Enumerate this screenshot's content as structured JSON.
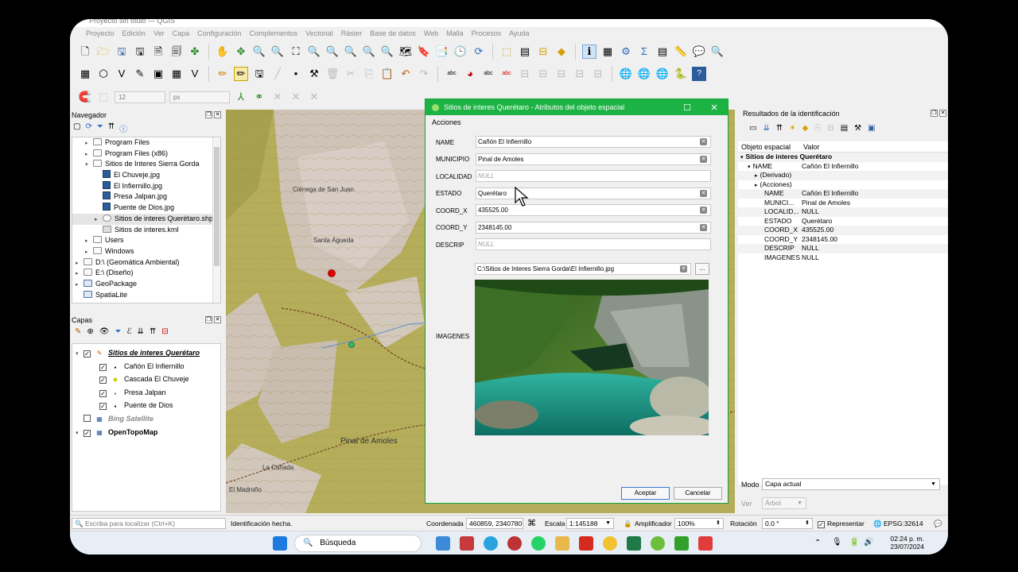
{
  "window": {
    "title": "Proyecto sin título — QGIS"
  },
  "menu": [
    "Proyecto",
    "Edición",
    "Ver",
    "Capa",
    "Configuración",
    "Complementos",
    "Vectorial",
    "Ráster",
    "Base de datos",
    "Web",
    "Malla",
    "Procesos",
    "Ayuda"
  ],
  "digitize": {
    "size_value": "12",
    "unit_value": "px"
  },
  "navigator": {
    "title": "Navegador",
    "items": [
      {
        "label": "Program Files",
        "indent": 1,
        "kind": "folder",
        "arrow": "▸"
      },
      {
        "label": "Program Files (x86)",
        "indent": 1,
        "kind": "folder",
        "arrow": "▸"
      },
      {
        "label": "Sitios de Interes Sierra Gorda",
        "indent": 1,
        "kind": "folder",
        "arrow": "▾"
      },
      {
        "label": "El Chuveje.jpg",
        "indent": 2,
        "kind": "image",
        "arrow": ""
      },
      {
        "label": "El Infiernillo.jpg",
        "indent": 2,
        "kind": "image",
        "arrow": ""
      },
      {
        "label": "Presa Jalpan.jpg",
        "indent": 2,
        "kind": "image",
        "arrow": ""
      },
      {
        "label": "Puente de Dios.jpg",
        "indent": 2,
        "kind": "image",
        "arrow": ""
      },
      {
        "label": "Sitios de interes Querétaro.shp",
        "indent": 2,
        "kind": "shp",
        "arrow": "▸"
      },
      {
        "label": "Sitios de interes.kml",
        "indent": 2,
        "kind": "kml",
        "arrow": ""
      },
      {
        "label": "Users",
        "indent": 1,
        "kind": "folder",
        "arrow": "▸"
      },
      {
        "label": "Windows",
        "indent": 1,
        "kind": "folder",
        "arrow": "▸"
      },
      {
        "label": "D:\\ (Geomática Ambiental)",
        "indent": 0,
        "kind": "folder",
        "arrow": "▸"
      },
      {
        "label": "E:\\ (Diseño)",
        "indent": 0,
        "kind": "folder",
        "arrow": "▸"
      },
      {
        "label": "GeoPackage",
        "indent": 0,
        "kind": "gpkg",
        "arrow": "▸"
      },
      {
        "label": "SpatiaLite",
        "indent": 0,
        "kind": "gpkg",
        "arrow": ""
      }
    ]
  },
  "layers": {
    "title": "Capas",
    "items": [
      {
        "label": "Sitios de interes Querétaro",
        "indent": 0,
        "checked": true,
        "style": "bold-underline",
        "sym": "pencil"
      },
      {
        "label": "Cañón El Infiernillo",
        "indent": 1,
        "checked": true,
        "style": "normal",
        "sym": "dot-black"
      },
      {
        "label": "Cascada El Chuveje",
        "indent": 1,
        "checked": true,
        "style": "normal",
        "sym": "diamond"
      },
      {
        "label": "Presa Jalpan",
        "indent": 1,
        "checked": true,
        "style": "normal",
        "sym": "dot-green"
      },
      {
        "label": "Puente de Dios",
        "indent": 1,
        "checked": true,
        "style": "normal",
        "sym": "dot-black"
      },
      {
        "label": "Bing Satellite",
        "indent": 0,
        "checked": false,
        "style": "italic-gray",
        "sym": "raster"
      },
      {
        "label": "OpenTopoMap",
        "indent": 0,
        "checked": true,
        "style": "bold",
        "sym": "raster"
      }
    ]
  },
  "map": {
    "labels": [
      "Ciénega de San Juan",
      "Santa Águeda",
      "Pinal de Amoles",
      "La Cañada",
      "El Madroño"
    ]
  },
  "dialog": {
    "title": "Sitios de interes Querétaro - Atributos del objeto espacial",
    "menu_actions": "Acciones",
    "fields": [
      {
        "label": "NAME",
        "value": "Cañón El Infiernillo",
        "null": false
      },
      {
        "label": "MUNICIPIO",
        "value": "Pinal de Amoles",
        "null": false
      },
      {
        "label": "LOCALIDAD",
        "value": "NULL",
        "null": true
      },
      {
        "label": "ESTADO",
        "value": "Querétaro",
        "null": false
      },
      {
        "label": "COORD_X",
        "value": "435525.00",
        "null": false
      },
      {
        "label": "COORD_Y",
        "value": "2348145.00",
        "null": false
      },
      {
        "label": "DESCRIP",
        "value": "NULL",
        "null": true
      }
    ],
    "imagenes_label": "IMAGENES",
    "image_path": "C:\\Sitios de Interes Sierra Gorda\\El Infiernillo.jpg",
    "browse_label": "...",
    "accept": "Aceptar",
    "cancel": "Cancelar"
  },
  "identify": {
    "title": "Resultados de la identificación",
    "col_feature": "Objeto espacial",
    "col_value": "Valor",
    "rows": [
      {
        "a": "Sitios de interes Querétaro",
        "b": "",
        "indent": 0,
        "bold": true,
        "arrow": "▾"
      },
      {
        "a": "NAME",
        "b": "Cañón El Infiernillo",
        "indent": 1,
        "bold": false,
        "arrow": "▾"
      },
      {
        "a": "(Derivado)",
        "b": "",
        "indent": 2,
        "bold": false,
        "arrow": "▸"
      },
      {
        "a": "(Acciones)",
        "b": "",
        "indent": 2,
        "bold": false,
        "arrow": "▸"
      },
      {
        "a": "NAME",
        "b": "Cañón El Infiernillo",
        "indent": 3,
        "bold": false,
        "arrow": ""
      },
      {
        "a": "MUNICI...",
        "b": "Pinal de Amoles",
        "indent": 3,
        "bold": false,
        "arrow": ""
      },
      {
        "a": "LOCALID...",
        "b": "NULL",
        "indent": 3,
        "bold": false,
        "arrow": ""
      },
      {
        "a": "ESTADO",
        "b": "Querétaro",
        "indent": 3,
        "bold": false,
        "arrow": ""
      },
      {
        "a": "COORD_X",
        "b": "435525.00",
        "indent": 3,
        "bold": false,
        "arrow": ""
      },
      {
        "a": "COORD_Y",
        "b": "2348145.00",
        "indent": 3,
        "bold": false,
        "arrow": ""
      },
      {
        "a": "DESCRIP",
        "b": "NULL",
        "indent": 3,
        "bold": false,
        "arrow": ""
      },
      {
        "a": "IMAGENES",
        "b": "NULL",
        "indent": 3,
        "bold": false,
        "arrow": ""
      }
    ],
    "mode_label": "Modo",
    "mode_value": "Capa actual",
    "view_label": "Ver",
    "view_value": "Árbol"
  },
  "status": {
    "locator_placeholder": "Escriba para localizar (Ctrl+K)",
    "message": "Identificación hecha.",
    "coord_label": "Coordenada",
    "coord_value": "460859, 2340780",
    "scale_label": "Escala",
    "scale_value": "1:145188",
    "magnifier_label": "Amplificador",
    "magnifier_value": "100%",
    "rotation_label": "Rotación",
    "rotation_value": "0.0 °",
    "render_label": "Representar",
    "crs": "EPSG:32614"
  },
  "taskbar": {
    "search": "Búsqueda",
    "time": "02:24 p. m.",
    "date": "23/07/2024"
  }
}
